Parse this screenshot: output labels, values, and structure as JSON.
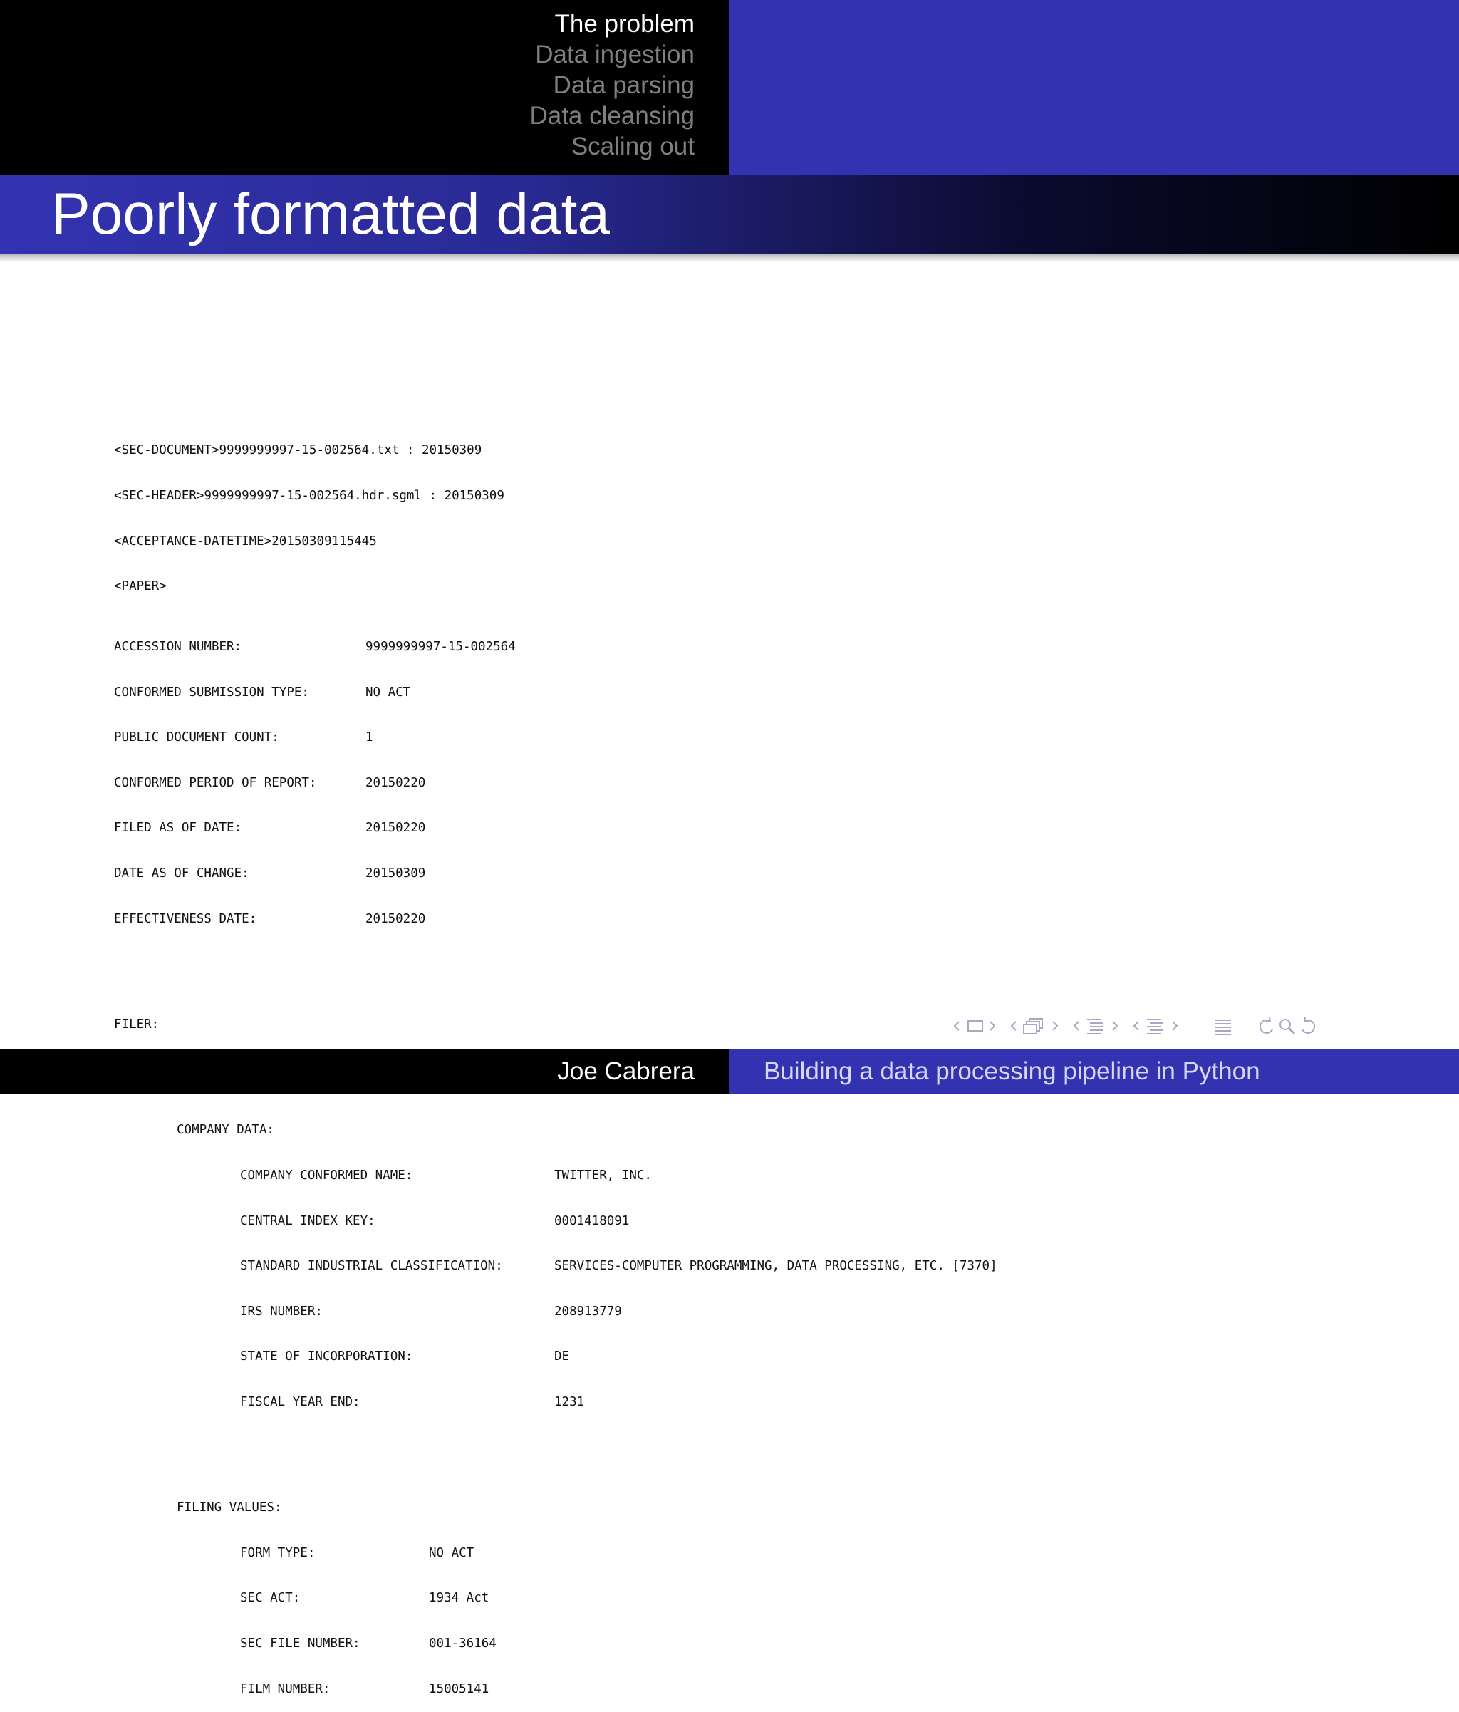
{
  "nav": {
    "sections": [
      "The problem",
      "Data ingestion",
      "Data parsing",
      "Data cleansing",
      "Scaling out"
    ],
    "active_index": 0
  },
  "frame": {
    "title": "Poorly formatted data"
  },
  "document": {
    "header_lines": [
      "<SEC-DOCUMENT>9999999997-15-002564.txt : 20150309",
      "<SEC-HEADER>9999999997-15-002564.hdr.sgml : 20150309",
      "<ACCEPTANCE-DATETIME>20150309115445",
      "<PAPER>"
    ],
    "fields": [
      {
        "label": "ACCESSION NUMBER:",
        "value": "9999999997-15-002564"
      },
      {
        "label": "CONFORMED SUBMISSION TYPE:",
        "value": "NO ACT"
      },
      {
        "label": "PUBLIC DOCUMENT COUNT:",
        "value": "1"
      },
      {
        "label": "CONFORMED PERIOD OF REPORT:",
        "value": "20150220"
      },
      {
        "label": "FILED AS OF DATE:",
        "value": "20150220"
      },
      {
        "label": "DATE AS OF CHANGE:",
        "value": "20150309"
      },
      {
        "label": "EFFECTIVENESS DATE:",
        "value": "20150220"
      }
    ],
    "filer_label": "FILER:",
    "company_data_label": "COMPANY DATA:",
    "company_data": [
      {
        "label": "COMPANY CONFORMED NAME:",
        "value": "TWITTER, INC."
      },
      {
        "label": "CENTRAL INDEX KEY:",
        "value": "0001418091"
      },
      {
        "label": "STANDARD INDUSTRIAL CLASSIFICATION:",
        "value": "SERVICES-COMPUTER PROGRAMMING, DATA PROCESSING, ETC. [7370]"
      },
      {
        "label": "IRS NUMBER:",
        "value": "208913779"
      },
      {
        "label": "STATE OF INCORPORATION:",
        "value": "DE"
      },
      {
        "label": "FISCAL YEAR END:",
        "value": "1231"
      }
    ],
    "filing_values_label": "FILING VALUES:",
    "filing_values": [
      {
        "label": "FORM TYPE:",
        "value": "NO ACT"
      },
      {
        "label": "SEC ACT:",
        "value": "1934 Act"
      },
      {
        "label": "SEC FILE NUMBER:",
        "value": "001-36164"
      },
      {
        "label": "FILM NUMBER:",
        "value": "15005141"
      }
    ]
  },
  "footer": {
    "author": "Joe Cabrera",
    "short_title": "Building a data processing pipeline in Python"
  },
  "colors": {
    "accent": "#3333b2",
    "bar_dark": "#000000",
    "nav_inactive": "#7f7f7f",
    "nav_symbols": "#a7a7c8"
  }
}
